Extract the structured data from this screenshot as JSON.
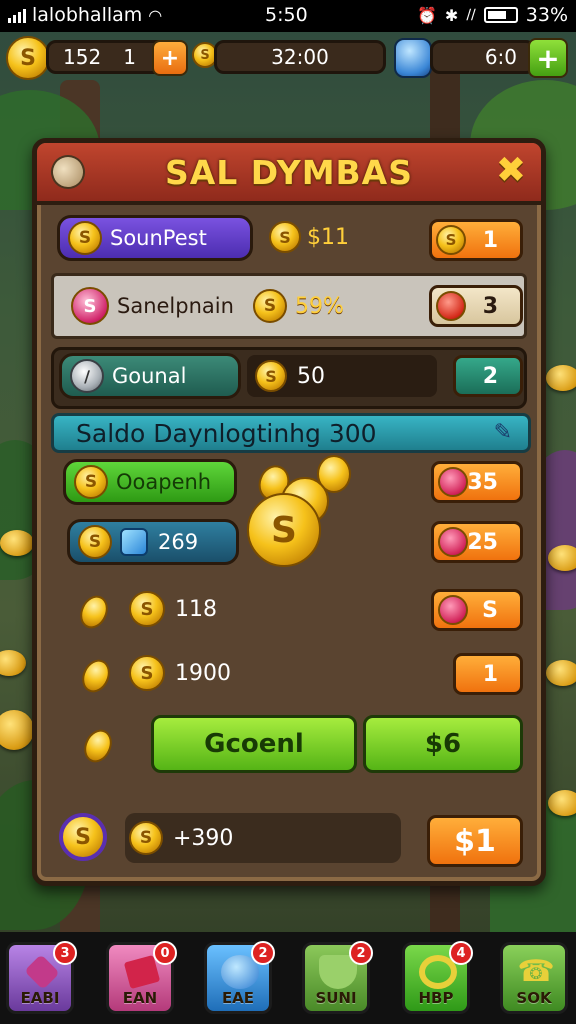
{
  "status_bar": {
    "carrier": "lalobhallam",
    "time": "5:50",
    "battery": "33%"
  },
  "top_bar": {
    "coins": "152",
    "coins_level": "1",
    "center_value": "32:00",
    "gems": "6:0"
  },
  "panel": {
    "title": "SAL DYMBAS",
    "row1": {
      "label": "SounPest",
      "amount": "$11",
      "badge": "1"
    },
    "row2": {
      "label": "Sanelpnain",
      "amount": "59%",
      "badge": "3"
    },
    "row3": {
      "label": "Gounal",
      "amount": "50",
      "badge": "2"
    },
    "banner": "Saldo Daynlogtinhg 300",
    "row4": {
      "label": "Ooapenh",
      "badge": "35"
    },
    "row5": {
      "amount": "269",
      "badge": "25"
    },
    "row6": {
      "amount": "118",
      "badge": "S"
    },
    "row7": {
      "amount": "1900",
      "badge": "1"
    },
    "buttons": {
      "left": "Gcoenl",
      "right": "$6"
    },
    "footer": {
      "amount": "+390",
      "button": "$1"
    }
  },
  "nav": [
    {
      "label": "EABI",
      "badge": "3",
      "color": "#8a4fb8"
    },
    {
      "label": "EAN",
      "badge": "0",
      "color": "#d65a9a"
    },
    {
      "label": "EAE",
      "badge": "2",
      "color": "#2f8fd6"
    },
    {
      "label": "SUNI",
      "badge": "2",
      "color": "#6aa83a"
    },
    {
      "label": "HBP",
      "badge": "4",
      "color": "#4cae2a"
    },
    {
      "label": "SOK",
      "badge": "",
      "color": "#5fa63a"
    }
  ]
}
